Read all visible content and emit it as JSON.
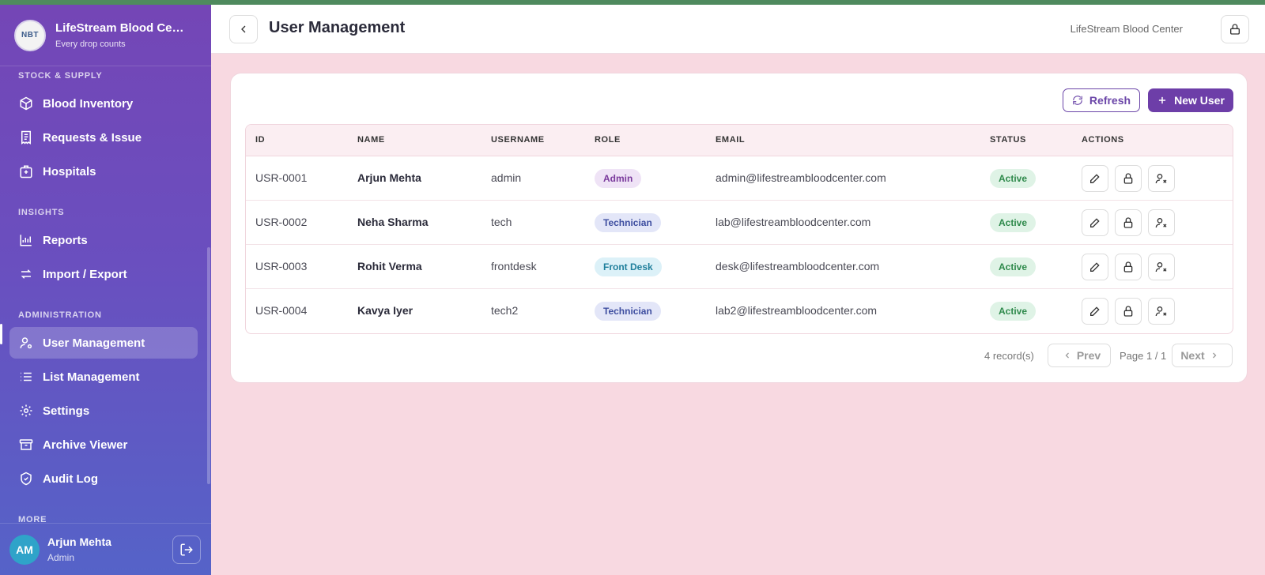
{
  "brand": {
    "title": "LifeStream Blood Center",
    "subtitle": "Every drop counts",
    "logo_text": "NBT"
  },
  "sidebar": {
    "sections": [
      {
        "label": "STOCK & SUPPLY",
        "items": [
          "Blood Inventory",
          "Requests & Issue",
          "Hospitals"
        ]
      },
      {
        "label": "INSIGHTS",
        "items": [
          "Reports",
          "Import / Export"
        ]
      },
      {
        "label": "ADMINISTRATION",
        "items": [
          "User Management",
          "List Management",
          "Settings",
          "Archive Viewer",
          "Audit Log"
        ]
      },
      {
        "label": "MORE",
        "items": []
      }
    ],
    "active_item": "User Management"
  },
  "user": {
    "initials": "AM",
    "name": "Arjun Mehta",
    "role": "Admin"
  },
  "header": {
    "title": "User Management",
    "org": "LifeStream Blood Center"
  },
  "toolbar": {
    "refresh_label": "Refresh",
    "new_label": "New User"
  },
  "table": {
    "columns": [
      "ID",
      "NAME",
      "USERNAME",
      "ROLE",
      "EMAIL",
      "STATUS",
      "ACTIONS"
    ],
    "rows": [
      {
        "id": "USR-0001",
        "name": "Arjun Mehta",
        "username": "admin",
        "role": "Admin",
        "email": "admin@lifestreambloodcenter.com",
        "status": "Active"
      },
      {
        "id": "USR-0002",
        "name": "Neha Sharma",
        "username": "tech",
        "role": "Technician",
        "email": "lab@lifestreambloodcenter.com",
        "status": "Active"
      },
      {
        "id": "USR-0003",
        "name": "Rohit Verma",
        "username": "frontdesk",
        "role": "Front Desk",
        "email": "desk@lifestreambloodcenter.com",
        "status": "Active"
      },
      {
        "id": "USR-0004",
        "name": "Kavya Iyer",
        "username": "tech2",
        "role": "Technician",
        "email": "lab2@lifestreambloodcenter.com",
        "status": "Active"
      }
    ]
  },
  "pagination": {
    "records": "4 record(s)",
    "prev": "Prev",
    "page": "Page 1 / 1",
    "next": "Next"
  },
  "colors": {
    "primary": "#6d3ea8",
    "page_bg": "#f8d9e1",
    "active_badge": "#2f8a4c"
  }
}
